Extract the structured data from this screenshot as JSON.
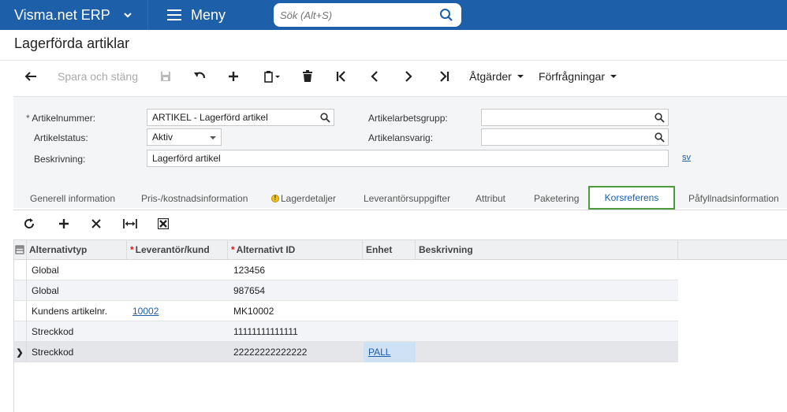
{
  "app": {
    "brand": "Visma.net ERP",
    "menu_label": "Meny",
    "search_placeholder": "Sök (Alt+S)"
  },
  "page": {
    "title": "Lagerförda artiklar"
  },
  "toolbar": {
    "save_close": "Spara och stäng",
    "actions": "Åtgärder",
    "inquiries": "Förfrågningar"
  },
  "form": {
    "item_number_label": "Artikelnummer:",
    "item_number_value": "ARTIKEL - Lagerförd artikel",
    "item_status_label": "Artikelstatus:",
    "item_status_value": "Aktiv",
    "description_label": "Beskrivning:",
    "description_value": "Lagerförd artikel",
    "workgroup_label": "Artikelarbetsgrupp:",
    "workgroup_value": "",
    "owner_label": "Artikelansvarig:",
    "owner_value": "",
    "lang_link": "sv"
  },
  "tabs": [
    {
      "label": "Generell information"
    },
    {
      "label": "Pris-/kostnadsinformation"
    },
    {
      "label": "Lagerdetaljer"
    },
    {
      "label": "Leverantörsuppgifter"
    },
    {
      "label": "Attribut"
    },
    {
      "label": "Paketering"
    },
    {
      "label": "Korsreferens"
    },
    {
      "label": "Påfyllnadsinformation"
    }
  ],
  "grid": {
    "columns": [
      "Alternativtyp",
      "Leverantör/kund",
      "Alternativt ID",
      "Enhet",
      "Beskrivning"
    ],
    "rows": [
      {
        "type": "Global",
        "vendor": "",
        "alt_id": "123456",
        "unit": "",
        "desc": ""
      },
      {
        "type": "Global",
        "vendor": "",
        "alt_id": "987654",
        "unit": "",
        "desc": ""
      },
      {
        "type": "Kundens artikelnr.",
        "vendor": "10002",
        "alt_id": "MK10002",
        "unit": "",
        "desc": ""
      },
      {
        "type": "Streckkod",
        "vendor": "",
        "alt_id": "11111111111111",
        "unit": "",
        "desc": ""
      },
      {
        "type": "Streckkod",
        "vendor": "",
        "alt_id": "22222222222222",
        "unit": "PALL",
        "desc": ""
      }
    ]
  },
  "colors": {
    "topbar": "#1d5fa8",
    "active_tab_border": "#4e9a3e",
    "link": "#1d5fa8",
    "required": "#d21f1f"
  }
}
